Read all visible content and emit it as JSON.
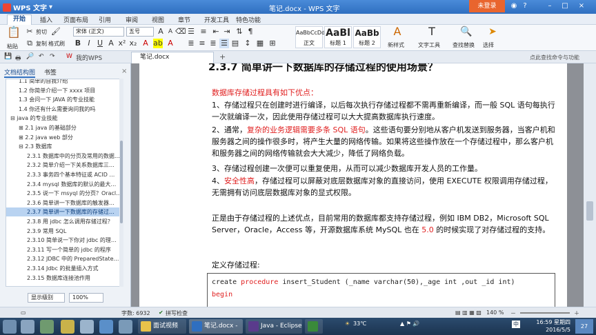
{
  "window": {
    "app_name": "WPS 文字",
    "title": "笔记.docx - WPS 文字",
    "login_label": "未登录",
    "min": "–",
    "max": "□",
    "close": "×"
  },
  "menu": {
    "tabs": [
      "开始",
      "插入",
      "页面布局",
      "引用",
      "审阅",
      "视图",
      "章节",
      "开发工具",
      "特色功能"
    ]
  },
  "ribbon": {
    "paste": "粘贴",
    "cut": "剪切",
    "copy": "复制",
    "format_painter": "格式刷",
    "font_name": "宋体 (正文)",
    "font_size": "五号",
    "styles": [
      {
        "preview": "AaBbCcDd",
        "label": "正文"
      },
      {
        "preview": "AaBl",
        "label": "标题 1"
      },
      {
        "preview": "AaBb",
        "label": "标题 2"
      }
    ],
    "new_style": "新样式",
    "text_tools": "文字工具",
    "find_replace": "查找替换",
    "select": "选择"
  },
  "quickbar": {
    "my_wps": "我的WPS",
    "doc_tab": "笔记.docx",
    "tip": "点此查找命令与功能"
  },
  "nav": {
    "tabs": [
      "文档结构图",
      "书签"
    ],
    "items": [
      {
        "text": "1.1 简单的自我介绍",
        "indent": 1
      },
      {
        "text": "1.2 你简单介绍一下 xxxx 项目",
        "indent": 1
      },
      {
        "text": "1.3 会问一下 JAVA 的专业技能",
        "indent": 1
      },
      {
        "text": "1.4 你还有什么需要询问我的吗",
        "indent": 1
      },
      {
        "text": "⊟ java 的专业技能",
        "indent": 0
      },
      {
        "text": "⊞ 2.1 java 的基础部分",
        "indent": 1
      },
      {
        "text": "⊞ 2.2 java web 部分",
        "indent": 1
      },
      {
        "text": "⊟ 2.3 数据库",
        "indent": 1
      },
      {
        "text": "2.3.1 数据库中的分页及常用的数据…",
        "indent": 2
      },
      {
        "text": "2.3.2 简单介绍一下关系数据库三…",
        "indent": 2
      },
      {
        "text": "2.3.3 事务四个基本特征或 ACID …",
        "indent": 2
      },
      {
        "text": "2.3.4 mysql 数据库的默认的最大…",
        "indent": 2
      },
      {
        "text": "2.3.5 说一下 msyql 的分页？Oracl…",
        "indent": 2
      },
      {
        "text": "2.3.6 简单讲一下数据库的触发器…",
        "indent": 2
      },
      {
        "text": "2.3.7 简单讲一下数据库的存储过…",
        "indent": 2,
        "selected": true
      },
      {
        "text": "2.3.8 用 jdbc 怎么调用存储过程？",
        "indent": 2
      },
      {
        "text": "2.3.9 常用 SQL",
        "indent": 2
      },
      {
        "text": "2.3.10 简单说一下你对 jdbc 的理…",
        "indent": 2
      },
      {
        "text": "2.3.11 写一个简单的 jdbc 的程序",
        "indent": 2
      },
      {
        "text": "2.3.12 JDBC 中的 PreparedState…",
        "indent": 2
      },
      {
        "text": "2.3.14 Jdbc 的批量插入方式",
        "indent": 2
      },
      {
        "text": "2.3.15 数据库连接池作用",
        "indent": 2
      }
    ],
    "level_label": "显示级别",
    "zoom_label": "100%"
  },
  "document": {
    "heading": "2.3.7  简单讲一下数据库的存储过程的使用场景？",
    "intro": "数据库存储过程具有如下优点：",
    "p1": "1、存储过程只在创建时进行编译，以后每次执行存储过程都不需再重新编译，而一般 SQL 语句每执行一次就编译一次，因此使用存储过程可以大大提高数据库执行速度。",
    "p2_a": "2、通常，",
    "p2_red": "复杂的业务逻辑需要多条 SQL 语句",
    "p2_b": "。这些语句要分别地从客户机发送到服务器，当客户机和服务器之间的操作很多时，将产生大量的网络传输。如果将这些操作放在一个存储过程中，那么客户机和服务器之间的网络传输就会大大减少，降低了网络负载。",
    "p3": "3、存储过程创建一次便可以重复使用，从而可以减少数据库开发人员的工作量。",
    "p4_a": "4、",
    "p4_red": "安全性高",
    "p4_b": "，存储过程可以屏蔽对底层数据库对象的直接访问，使用 EXECUTE 权限调用存储过程，无需拥有访问底层数据库对象的显式权限。",
    "p5_a": "正是由于存储过程的上述优点，目前常用的数据库都支持存储过程，例如 IBM DB2，Microsoft SQL Server，Oracle，Access 等，开源数据库系统 MySQL 也在 ",
    "p5_red": "5.0",
    "p5_b": " 的时候实现了对存储过程的支持。",
    "define": "定义存储过程:",
    "code1_a": "create ",
    "code1_red": "procedure",
    "code1_b": " insert_Student (_name varchar(50),_age int ,out _id int)",
    "code2": "begin"
  },
  "status": {
    "word_count": "字数: 6932",
    "spell": "拼写检查",
    "zoom": "140 %"
  },
  "taskbar": {
    "items": [
      "面试视频",
      "笔记.docx - W…",
      "Java - Eclipse"
    ],
    "temp": "33℃",
    "ime": "中",
    "time": "16:59 星期四",
    "date": "2016/5/5",
    "badge": "27"
  }
}
